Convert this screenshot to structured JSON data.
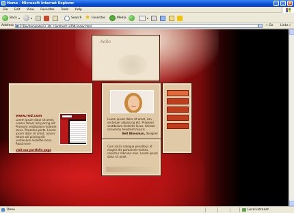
{
  "window": {
    "title": "Home - Microsoft Internet Explorer",
    "minimize": "_",
    "maximize": "□",
    "close": "×"
  },
  "menu": [
    "File",
    "Edit",
    "View",
    "Favorites",
    "Tools",
    "Help"
  ],
  "toolbar": {
    "back_label": "Back",
    "search_label": "Search",
    "favorites_label": "Favorites",
    "media_label": "Media"
  },
  "address": {
    "label": "Address",
    "value": "F:\\Dev\\templates\\3_3b\\_clienthost\\_HTML\\index.html",
    "go_label": "Go",
    "links_label": "Links"
  },
  "page": {
    "scribble": "hello",
    "left": {
      "site": "www.red.com",
      "body": "Lorem ipsum dolor sit amet, consec tetuer adi piscing elit. Praesent vestibulum molestie lacus. Phasellus porta. Lorem ipsum dolor sit amet, consec tetuer adi piscing elit vestibulum molestie lacus. Read more",
      "more": "visit our portfolio page"
    },
    "center": {
      "body": "Lorem ipsum dolor sit amet, con sectetuer adipiscing elit. Praesent vestibulum molestie lacus. Aenean nonummy hendrerit mauris.",
      "author_name": "Bell Bluesman,",
      "author_role": "designer"
    },
    "right_nav_count": 5,
    "bottom": {
      "body": "Cum sociis natoque penatibus et magnis dis parturient montes, nascetur ridiculus mus. Lorem ipsum dolor sit amet"
    }
  },
  "status": {
    "left": "Done",
    "zone": "Local intranet"
  },
  "colors": {
    "titlebar": "#0a4fd6",
    "accent_red": "#a31212",
    "panel": "#dfc9a6",
    "nav": "#c13c1a"
  }
}
